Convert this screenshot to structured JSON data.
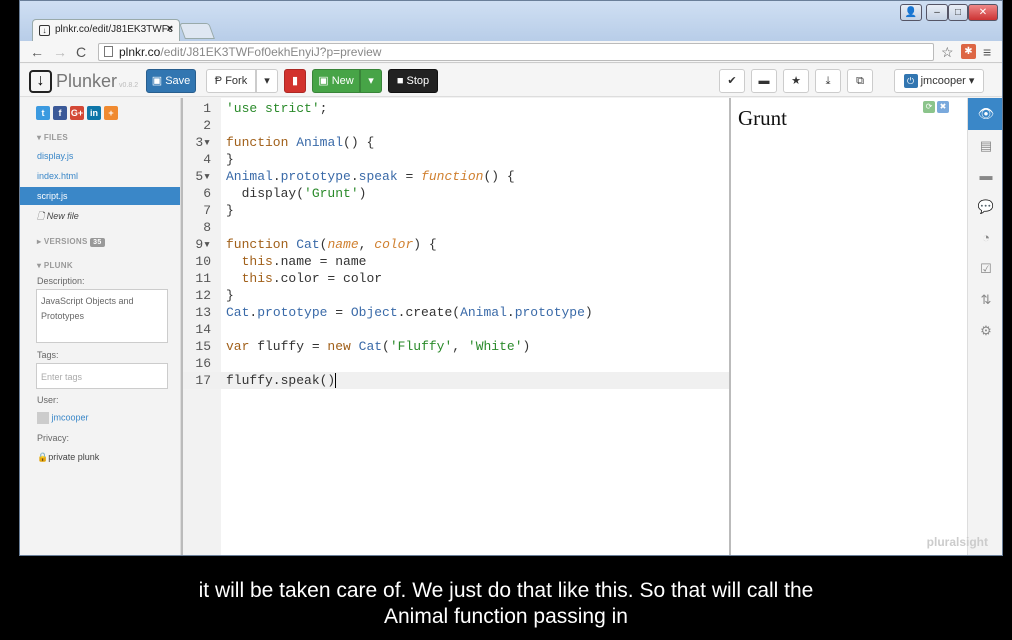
{
  "browser": {
    "tab_title": "plnkr.co/edit/J81EK3TWFc",
    "tab_close": "×",
    "url_host": "plnkr.co",
    "url_path": "/edit/J81EK3TWFof0ekhEnyiJ?p=preview"
  },
  "toolbar": {
    "brand": "Plunker",
    "version": "v0.8.2",
    "save": "Save",
    "fork": "Fork",
    "new": "New",
    "stop": "Stop",
    "user": "jmcooper"
  },
  "sidebar": {
    "files_header": "▾ FILES",
    "files": [
      "display.js",
      "index.html",
      "script.js"
    ],
    "active_file": "script.js",
    "new_file": "New file",
    "versions_header": "▸ VERSIONS",
    "versions_count": "35",
    "plunk_header": "▾ PLUNK",
    "description_label": "Description:",
    "description": "JavaScript Objects and Prototypes",
    "tags_label": "Tags:",
    "tags_placeholder": "Enter tags",
    "user_label": "User:",
    "user": "jmcooper",
    "privacy_label": "Privacy:",
    "privacy": "private plunk"
  },
  "editor": {
    "current_line": 17
  },
  "preview": {
    "output": "Grunt"
  },
  "watermark": "pluralsight",
  "caption": {
    "line1": "it will be taken care of. We just do that like this. So that will call the",
    "line2": "Animal function passing in"
  },
  "colors": {
    "primary": "#3276b1",
    "danger": "#d2322d",
    "success": "#47a447",
    "active_nav": "#3a87c8"
  }
}
